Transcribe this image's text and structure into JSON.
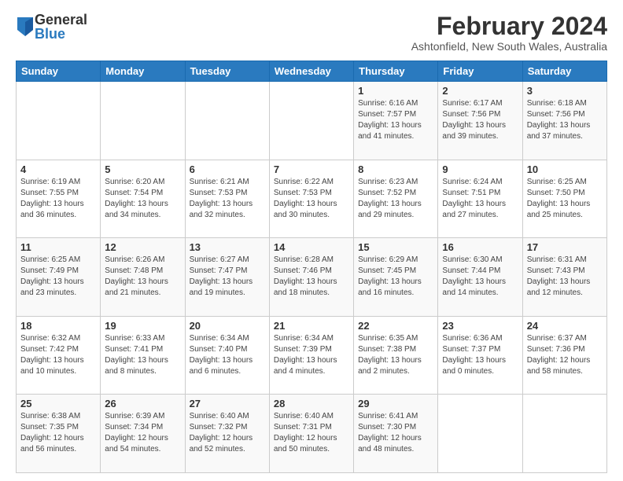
{
  "logo": {
    "general": "General",
    "blue": "Blue"
  },
  "title": "February 2024",
  "subtitle": "Ashtonfield, New South Wales, Australia",
  "headers": [
    "Sunday",
    "Monday",
    "Tuesday",
    "Wednesday",
    "Thursday",
    "Friday",
    "Saturday"
  ],
  "weeks": [
    [
      {
        "day": "",
        "info": ""
      },
      {
        "day": "",
        "info": ""
      },
      {
        "day": "",
        "info": ""
      },
      {
        "day": "",
        "info": ""
      },
      {
        "day": "1",
        "info": "Sunrise: 6:16 AM\nSunset: 7:57 PM\nDaylight: 13 hours and 41 minutes."
      },
      {
        "day": "2",
        "info": "Sunrise: 6:17 AM\nSunset: 7:56 PM\nDaylight: 13 hours and 39 minutes."
      },
      {
        "day": "3",
        "info": "Sunrise: 6:18 AM\nSunset: 7:56 PM\nDaylight: 13 hours and 37 minutes."
      }
    ],
    [
      {
        "day": "4",
        "info": "Sunrise: 6:19 AM\nSunset: 7:55 PM\nDaylight: 13 hours and 36 minutes."
      },
      {
        "day": "5",
        "info": "Sunrise: 6:20 AM\nSunset: 7:54 PM\nDaylight: 13 hours and 34 minutes."
      },
      {
        "day": "6",
        "info": "Sunrise: 6:21 AM\nSunset: 7:53 PM\nDaylight: 13 hours and 32 minutes."
      },
      {
        "day": "7",
        "info": "Sunrise: 6:22 AM\nSunset: 7:53 PM\nDaylight: 13 hours and 30 minutes."
      },
      {
        "day": "8",
        "info": "Sunrise: 6:23 AM\nSunset: 7:52 PM\nDaylight: 13 hours and 29 minutes."
      },
      {
        "day": "9",
        "info": "Sunrise: 6:24 AM\nSunset: 7:51 PM\nDaylight: 13 hours and 27 minutes."
      },
      {
        "day": "10",
        "info": "Sunrise: 6:25 AM\nSunset: 7:50 PM\nDaylight: 13 hours and 25 minutes."
      }
    ],
    [
      {
        "day": "11",
        "info": "Sunrise: 6:25 AM\nSunset: 7:49 PM\nDaylight: 13 hours and 23 minutes."
      },
      {
        "day": "12",
        "info": "Sunrise: 6:26 AM\nSunset: 7:48 PM\nDaylight: 13 hours and 21 minutes."
      },
      {
        "day": "13",
        "info": "Sunrise: 6:27 AM\nSunset: 7:47 PM\nDaylight: 13 hours and 19 minutes."
      },
      {
        "day": "14",
        "info": "Sunrise: 6:28 AM\nSunset: 7:46 PM\nDaylight: 13 hours and 18 minutes."
      },
      {
        "day": "15",
        "info": "Sunrise: 6:29 AM\nSunset: 7:45 PM\nDaylight: 13 hours and 16 minutes."
      },
      {
        "day": "16",
        "info": "Sunrise: 6:30 AM\nSunset: 7:44 PM\nDaylight: 13 hours and 14 minutes."
      },
      {
        "day": "17",
        "info": "Sunrise: 6:31 AM\nSunset: 7:43 PM\nDaylight: 13 hours and 12 minutes."
      }
    ],
    [
      {
        "day": "18",
        "info": "Sunrise: 6:32 AM\nSunset: 7:42 PM\nDaylight: 13 hours and 10 minutes."
      },
      {
        "day": "19",
        "info": "Sunrise: 6:33 AM\nSunset: 7:41 PM\nDaylight: 13 hours and 8 minutes."
      },
      {
        "day": "20",
        "info": "Sunrise: 6:34 AM\nSunset: 7:40 PM\nDaylight: 13 hours and 6 minutes."
      },
      {
        "day": "21",
        "info": "Sunrise: 6:34 AM\nSunset: 7:39 PM\nDaylight: 13 hours and 4 minutes."
      },
      {
        "day": "22",
        "info": "Sunrise: 6:35 AM\nSunset: 7:38 PM\nDaylight: 13 hours and 2 minutes."
      },
      {
        "day": "23",
        "info": "Sunrise: 6:36 AM\nSunset: 7:37 PM\nDaylight: 13 hours and 0 minutes."
      },
      {
        "day": "24",
        "info": "Sunrise: 6:37 AM\nSunset: 7:36 PM\nDaylight: 12 hours and 58 minutes."
      }
    ],
    [
      {
        "day": "25",
        "info": "Sunrise: 6:38 AM\nSunset: 7:35 PM\nDaylight: 12 hours and 56 minutes."
      },
      {
        "day": "26",
        "info": "Sunrise: 6:39 AM\nSunset: 7:34 PM\nDaylight: 12 hours and 54 minutes."
      },
      {
        "day": "27",
        "info": "Sunrise: 6:40 AM\nSunset: 7:32 PM\nDaylight: 12 hours and 52 minutes."
      },
      {
        "day": "28",
        "info": "Sunrise: 6:40 AM\nSunset: 7:31 PM\nDaylight: 12 hours and 50 minutes."
      },
      {
        "day": "29",
        "info": "Sunrise: 6:41 AM\nSunset: 7:30 PM\nDaylight: 12 hours and 48 minutes."
      },
      {
        "day": "",
        "info": ""
      },
      {
        "day": "",
        "info": ""
      }
    ]
  ]
}
